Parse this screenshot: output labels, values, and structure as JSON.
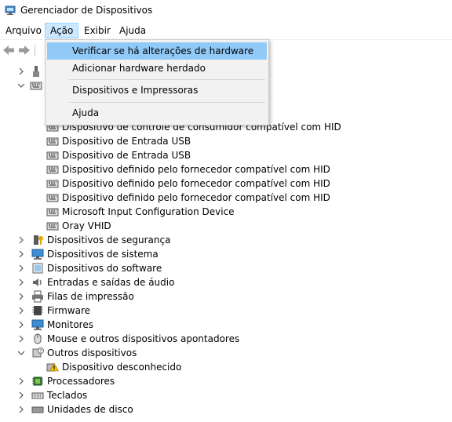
{
  "window": {
    "title": "Gerenciador de Dispositivos"
  },
  "menubar": [
    {
      "label": "Arquivo",
      "x": 0
    },
    {
      "label": "Ação",
      "active": true
    },
    {
      "label": "Exibir"
    },
    {
      "label": "Ajuda"
    }
  ],
  "menu_acao": {
    "items": [
      "Verificar se há alterações de hardware",
      "Adicionar hardware herdado",
      "Dispositivos e Impressoras",
      "Ajuda"
    ],
    "highlighted_index": 0
  },
  "tree": {
    "child_devices": [
      {
        "label": "Dispositivo de controle de consumidor compatível com HID",
        "icon": "hid-keyboard-icon"
      },
      {
        "label": "Dispositivo de Entrada USB",
        "icon": "hid-keyboard-icon"
      },
      {
        "label": "Dispositivo de Entrada USB",
        "icon": "hid-keyboard-icon"
      },
      {
        "label": "Dispositivo definido pelo fornecedor compatível com HID",
        "icon": "hid-keyboard-icon"
      },
      {
        "label": "Dispositivo definido pelo fornecedor compatível com HID",
        "icon": "hid-keyboard-icon"
      },
      {
        "label": "Dispositivo definido pelo fornecedor compatível com HID",
        "icon": "hid-keyboard-icon"
      },
      {
        "label": "Microsoft Input Configuration Device",
        "icon": "hid-keyboard-icon"
      },
      {
        "label": "Oray VHID",
        "icon": "hid-keyboard-icon"
      }
    ],
    "categories": [
      {
        "label": "Dispositivos de segurança",
        "icon": "security-device-icon",
        "state": "collapsed"
      },
      {
        "label": "Dispositivos de sistema",
        "icon": "system-device-icon",
        "state": "collapsed"
      },
      {
        "label": "Dispositivos do software",
        "icon": "software-device-icon",
        "state": "collapsed"
      },
      {
        "label": "Entradas e saídas de áudio",
        "icon": "speaker-icon",
        "state": "collapsed"
      },
      {
        "label": "Filas de impressão",
        "icon": "printer-icon",
        "state": "collapsed"
      },
      {
        "label": "Firmware",
        "icon": "firmware-icon",
        "state": "collapsed"
      },
      {
        "label": "Monitores",
        "icon": "monitor-icon",
        "state": "collapsed"
      },
      {
        "label": "Mouse e outros dispositivos apontadores",
        "icon": "mouse-icon",
        "state": "collapsed"
      },
      {
        "label": "Outros dispositivos",
        "icon": "unknown-device-icon",
        "state": "expanded"
      },
      {
        "label": "Dispositivo desconhecido",
        "icon": "warning-icon",
        "state": "child"
      },
      {
        "label": "Processadores",
        "icon": "processor-icon",
        "state": "collapsed"
      },
      {
        "label": "Teclados",
        "icon": "keyboard-icon",
        "state": "collapsed"
      },
      {
        "label": "Unidades de disco",
        "icon": "disk-drive-icon",
        "state": "collapsed"
      }
    ]
  }
}
